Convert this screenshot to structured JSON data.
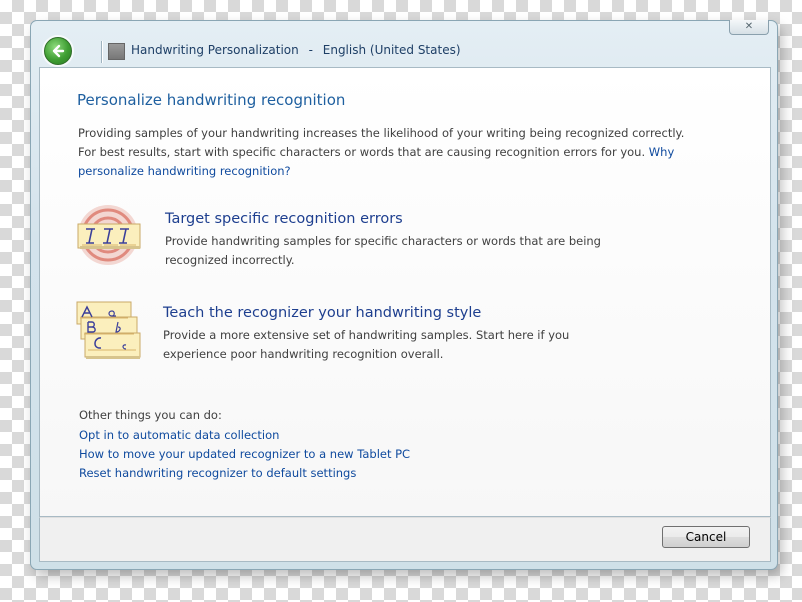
{
  "window": {
    "breadcrumb": [
      "Handwriting Personalization",
      "English (United States)"
    ],
    "breadcrumb_sep": "-",
    "close_glyph": "✕"
  },
  "main": {
    "heading": "Personalize handwriting recognition",
    "intro_text": "Providing samples of your handwriting increases the likelihood of your writing being recognized correctly. For best results, start with specific characters or words that are causing recognition errors for you.",
    "intro_link": "Why personalize handwriting recognition?",
    "options": [
      {
        "title": "Target specific recognition errors",
        "description": "Provide handwriting samples for specific characters or words that are being recognized incorrectly.",
        "icon": "target-handwriting-icon"
      },
      {
        "title": "Teach the recognizer your handwriting style",
        "description": "Provide a more extensive set of handwriting samples. Start here if you experience poor handwriting recognition overall.",
        "icon": "handwriting-samples-icon"
      }
    ],
    "other_label": "Other things you can do:",
    "other_links": [
      "Opt in to automatic data collection",
      "How to move your updated recognizer to a new Tablet PC",
      "Reset handwriting recognizer to default settings"
    ]
  },
  "footer": {
    "cancel_label": "Cancel"
  },
  "colors": {
    "heading": "#1e5f9f",
    "link": "#0f4a9e",
    "option_title": "#1e3f8f",
    "body_text": "#404040"
  }
}
